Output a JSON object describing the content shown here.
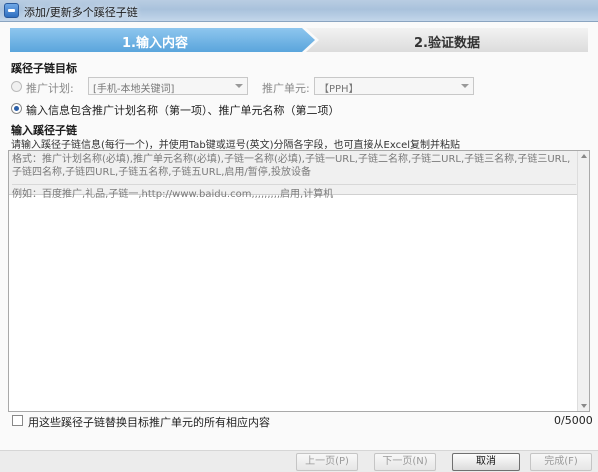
{
  "window": {
    "title": "添加/更新多个蹊径子链"
  },
  "steps": {
    "step1": "1.输入内容",
    "step2": "2.验证数据"
  },
  "target": {
    "heading": "蹊径子链目标",
    "plan_label": "推广计划:",
    "plan_value": "[手机-本地关键词]",
    "unit_label": "推广单元:",
    "unit_value": "【PPH】",
    "option2_label": "输入信息包含推广计划名称（第一项）、推广单元名称（第二项）"
  },
  "input": {
    "heading": "输入蹊径子链",
    "instruction": "请输入蹊径子链信息(每行一个)，并使用Tab键或逗号(英文)分隔各字段，也可直接从Excel复制并粘贴",
    "format_hint": "格式：推广计划名称(必填),推广单元名称(必填),子链一名称(必填),子链一URL,子链二名称,子链二URL,子链三名称,子链三URL,子链四名称,子链四URL,子链五名称,子链五URL,启用/暂停,投放设备",
    "example_hint": "例如：百度推广,礼品,子链一,http://www.baidu.com,,,,,,,,,启用,计算机",
    "value": ""
  },
  "replace_checkbox_label": "用这些蹊径子链替换目标推广单元的所有相应内容",
  "counter": "0/5000",
  "buttons": {
    "prev": "上一页(P)",
    "next": "下一页(N)",
    "cancel": "取消",
    "finish": "完成(F)"
  }
}
